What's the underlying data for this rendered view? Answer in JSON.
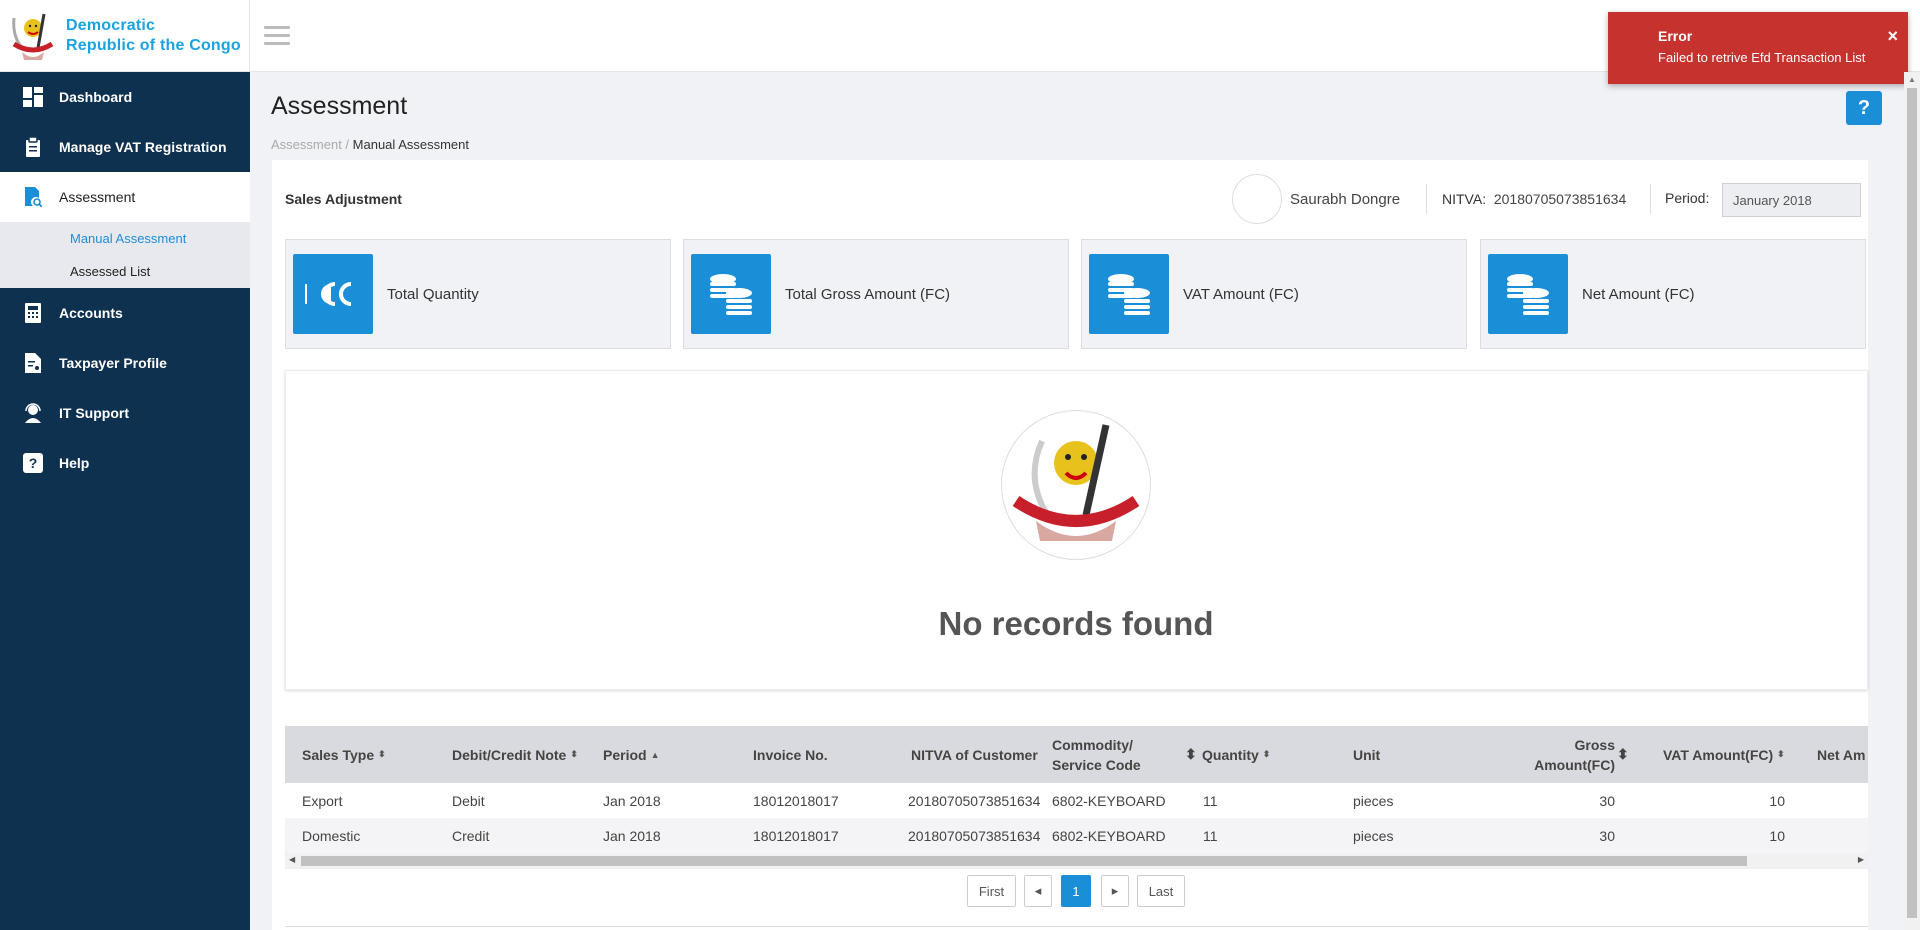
{
  "brand": {
    "line1": "Democratic",
    "line2": "Republic of the Congo"
  },
  "sidebar": {
    "items": [
      {
        "label": "Dashboard",
        "icon": "dashboard-icon"
      },
      {
        "label": "Manage VAT Registration",
        "icon": "clipboard-icon"
      },
      {
        "label": "Assessment",
        "icon": "document-search-icon"
      },
      {
        "label": "Accounts",
        "icon": "calculator-icon"
      },
      {
        "label": "Taxpayer Profile",
        "icon": "profile-doc-icon"
      },
      {
        "label": "IT Support",
        "icon": "support-agent-icon"
      },
      {
        "label": "Help",
        "icon": "question-icon"
      }
    ],
    "assessment_sub": [
      {
        "label": "Manual Assessment"
      },
      {
        "label": "Assessed List"
      }
    ]
  },
  "toast": {
    "title": "Error",
    "message": "Failed to retrive Efd Transaction List",
    "close": "×"
  },
  "page": {
    "title": "Assessment",
    "breadcrumb_root": "Assessment",
    "breadcrumb_sep": " / ",
    "breadcrumb_current": "Manual Assessment",
    "help": "?"
  },
  "header": {
    "section_title": "Sales Adjustment",
    "user_name": "Saurabh Dongre",
    "nitva_label": "NITVA:",
    "nitva_value": "20180705073851634",
    "period_label": "Period:",
    "period_value": "January 2018"
  },
  "stats": [
    {
      "label": "Total Quantity",
      "icon": "quantity-icon"
    },
    {
      "label": "Total Gross Amount (FC)",
      "icon": "coins-icon"
    },
    {
      "label": "VAT Amount (FC)",
      "icon": "coins-icon"
    },
    {
      "label": "Net Amount (FC)",
      "icon": "coins-icon"
    }
  ],
  "empty": {
    "message": "No records found"
  },
  "table": {
    "headers": [
      {
        "label": "Sales Type",
        "sort": "⬍"
      },
      {
        "label": "Debit/Credit Note",
        "sort": "⬍"
      },
      {
        "label": "Period",
        "sort": "▲"
      },
      {
        "label": "Invoice No.",
        "sort": ""
      },
      {
        "label": "NITVA of Customer",
        "sort": ""
      },
      {
        "label": "Commodity/\nService Code",
        "sort": "⬍"
      },
      {
        "label": "Quantity",
        "sort": "⬍"
      },
      {
        "label": "Unit",
        "sort": ""
      },
      {
        "label": "Gross\nAmount(FC)",
        "sort": "⬍"
      },
      {
        "label": "VAT Amount(FC)",
        "sort": "⬍"
      },
      {
        "label": "Net Am",
        "sort": ""
      }
    ],
    "rows": [
      [
        "Export",
        "Debit",
        "Jan 2018",
        "18012018017",
        "20180705073851634",
        "6802-KEYBOARD",
        "11",
        "pieces",
        "30",
        "10"
      ],
      [
        "Domestic",
        "Credit",
        "Jan 2018",
        "18012018017",
        "20180705073851634",
        "6802-KEYBOARD",
        "11",
        "pieces",
        "30",
        "10"
      ]
    ]
  },
  "pagination": {
    "first": "First",
    "prev": "◂",
    "page": "1",
    "next": "▸",
    "last": "Last"
  },
  "colors": {
    "sidebar": "#0f3150",
    "accent": "#1a8fd8",
    "error": "#c6322e"
  }
}
